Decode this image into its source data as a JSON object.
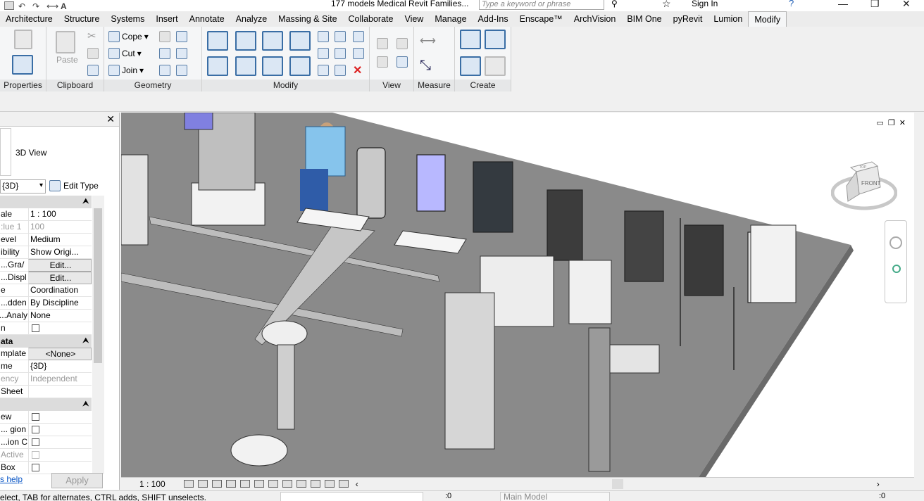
{
  "window": {
    "title": "177 models Medical Revit Families...",
    "search_placeholder": "Type a keyword or phrase",
    "sign_in": "Sign In"
  },
  "tabs": [
    "Architecture",
    "Structure",
    "Systems",
    "Insert",
    "Annotate",
    "Analyze",
    "Massing & Site",
    "Collaborate",
    "View",
    "Manage",
    "Add-Ins",
    "Enscape™",
    "ArchVision",
    "BIM One",
    "pyRevit",
    "Lumion",
    "Modify"
  ],
  "active_tab": "Modify",
  "ribbon": {
    "panels": {
      "properties": "Properties",
      "clipboard": "Clipboard",
      "geometry": "Geometry",
      "modify": "Modify",
      "view": "View",
      "measure": "Measure",
      "create": "Create"
    },
    "paste": "Paste",
    "cope": "Cope",
    "cut": "Cut",
    "join": "Join"
  },
  "properties": {
    "type_name": "3D View",
    "type_selector": "{3D}",
    "edit_type": "Edit Type",
    "rows": [
      {
        "key": "ale",
        "value": "1 : 100"
      },
      {
        "key": "lue   1:",
        "value": "100",
        "gray": true
      },
      {
        "key": "evel",
        "value": "Medium"
      },
      {
        "key": "ibility",
        "value": "Show Origi..."
      },
      {
        "key": "/Gra...",
        "value": "Edit...",
        "button": true
      },
      {
        "key": "Displ...",
        "value": "Edit...",
        "button": true
      },
      {
        "key": "e",
        "value": "Coordination"
      },
      {
        "key": "dden...",
        "value": "By Discipline"
      },
      {
        "key": "Analy...",
        "value": "None"
      },
      {
        "key": "n",
        "value": "",
        "checkbox": true
      }
    ],
    "section_data": "ata",
    "rows2": [
      {
        "key": "mplate",
        "value": "<None>",
        "button": true
      },
      {
        "key": "me",
        "value": "{3D}"
      },
      {
        "key": "ency",
        "value": "Independent",
        "gray": true
      },
      {
        "key": "Sheet",
        "value": ""
      }
    ],
    "rows3": [
      {
        "key": "ew",
        "value": "",
        "checkbox": true
      },
      {
        "key": "gion ...",
        "value": "",
        "checkbox": true
      },
      {
        "key": "ion C...",
        "value": "",
        "checkbox": true
      },
      {
        "key": "Active",
        "value": "",
        "checkbox": true,
        "gray": true
      },
      {
        "key": "Box",
        "value": "",
        "checkbox": true
      }
    ],
    "help_link": "s help",
    "apply": "Apply"
  },
  "viewcube": {
    "top": "TOP",
    "front": "FRONT"
  },
  "view_bar": {
    "scale": "1 : 100"
  },
  "status_bar": {
    "message": "elect, TAB for alternates, CTRL adds, SHIFT unselects.",
    "design_count": ":0",
    "active_model": "Main Model",
    "filter_count": ":0"
  }
}
